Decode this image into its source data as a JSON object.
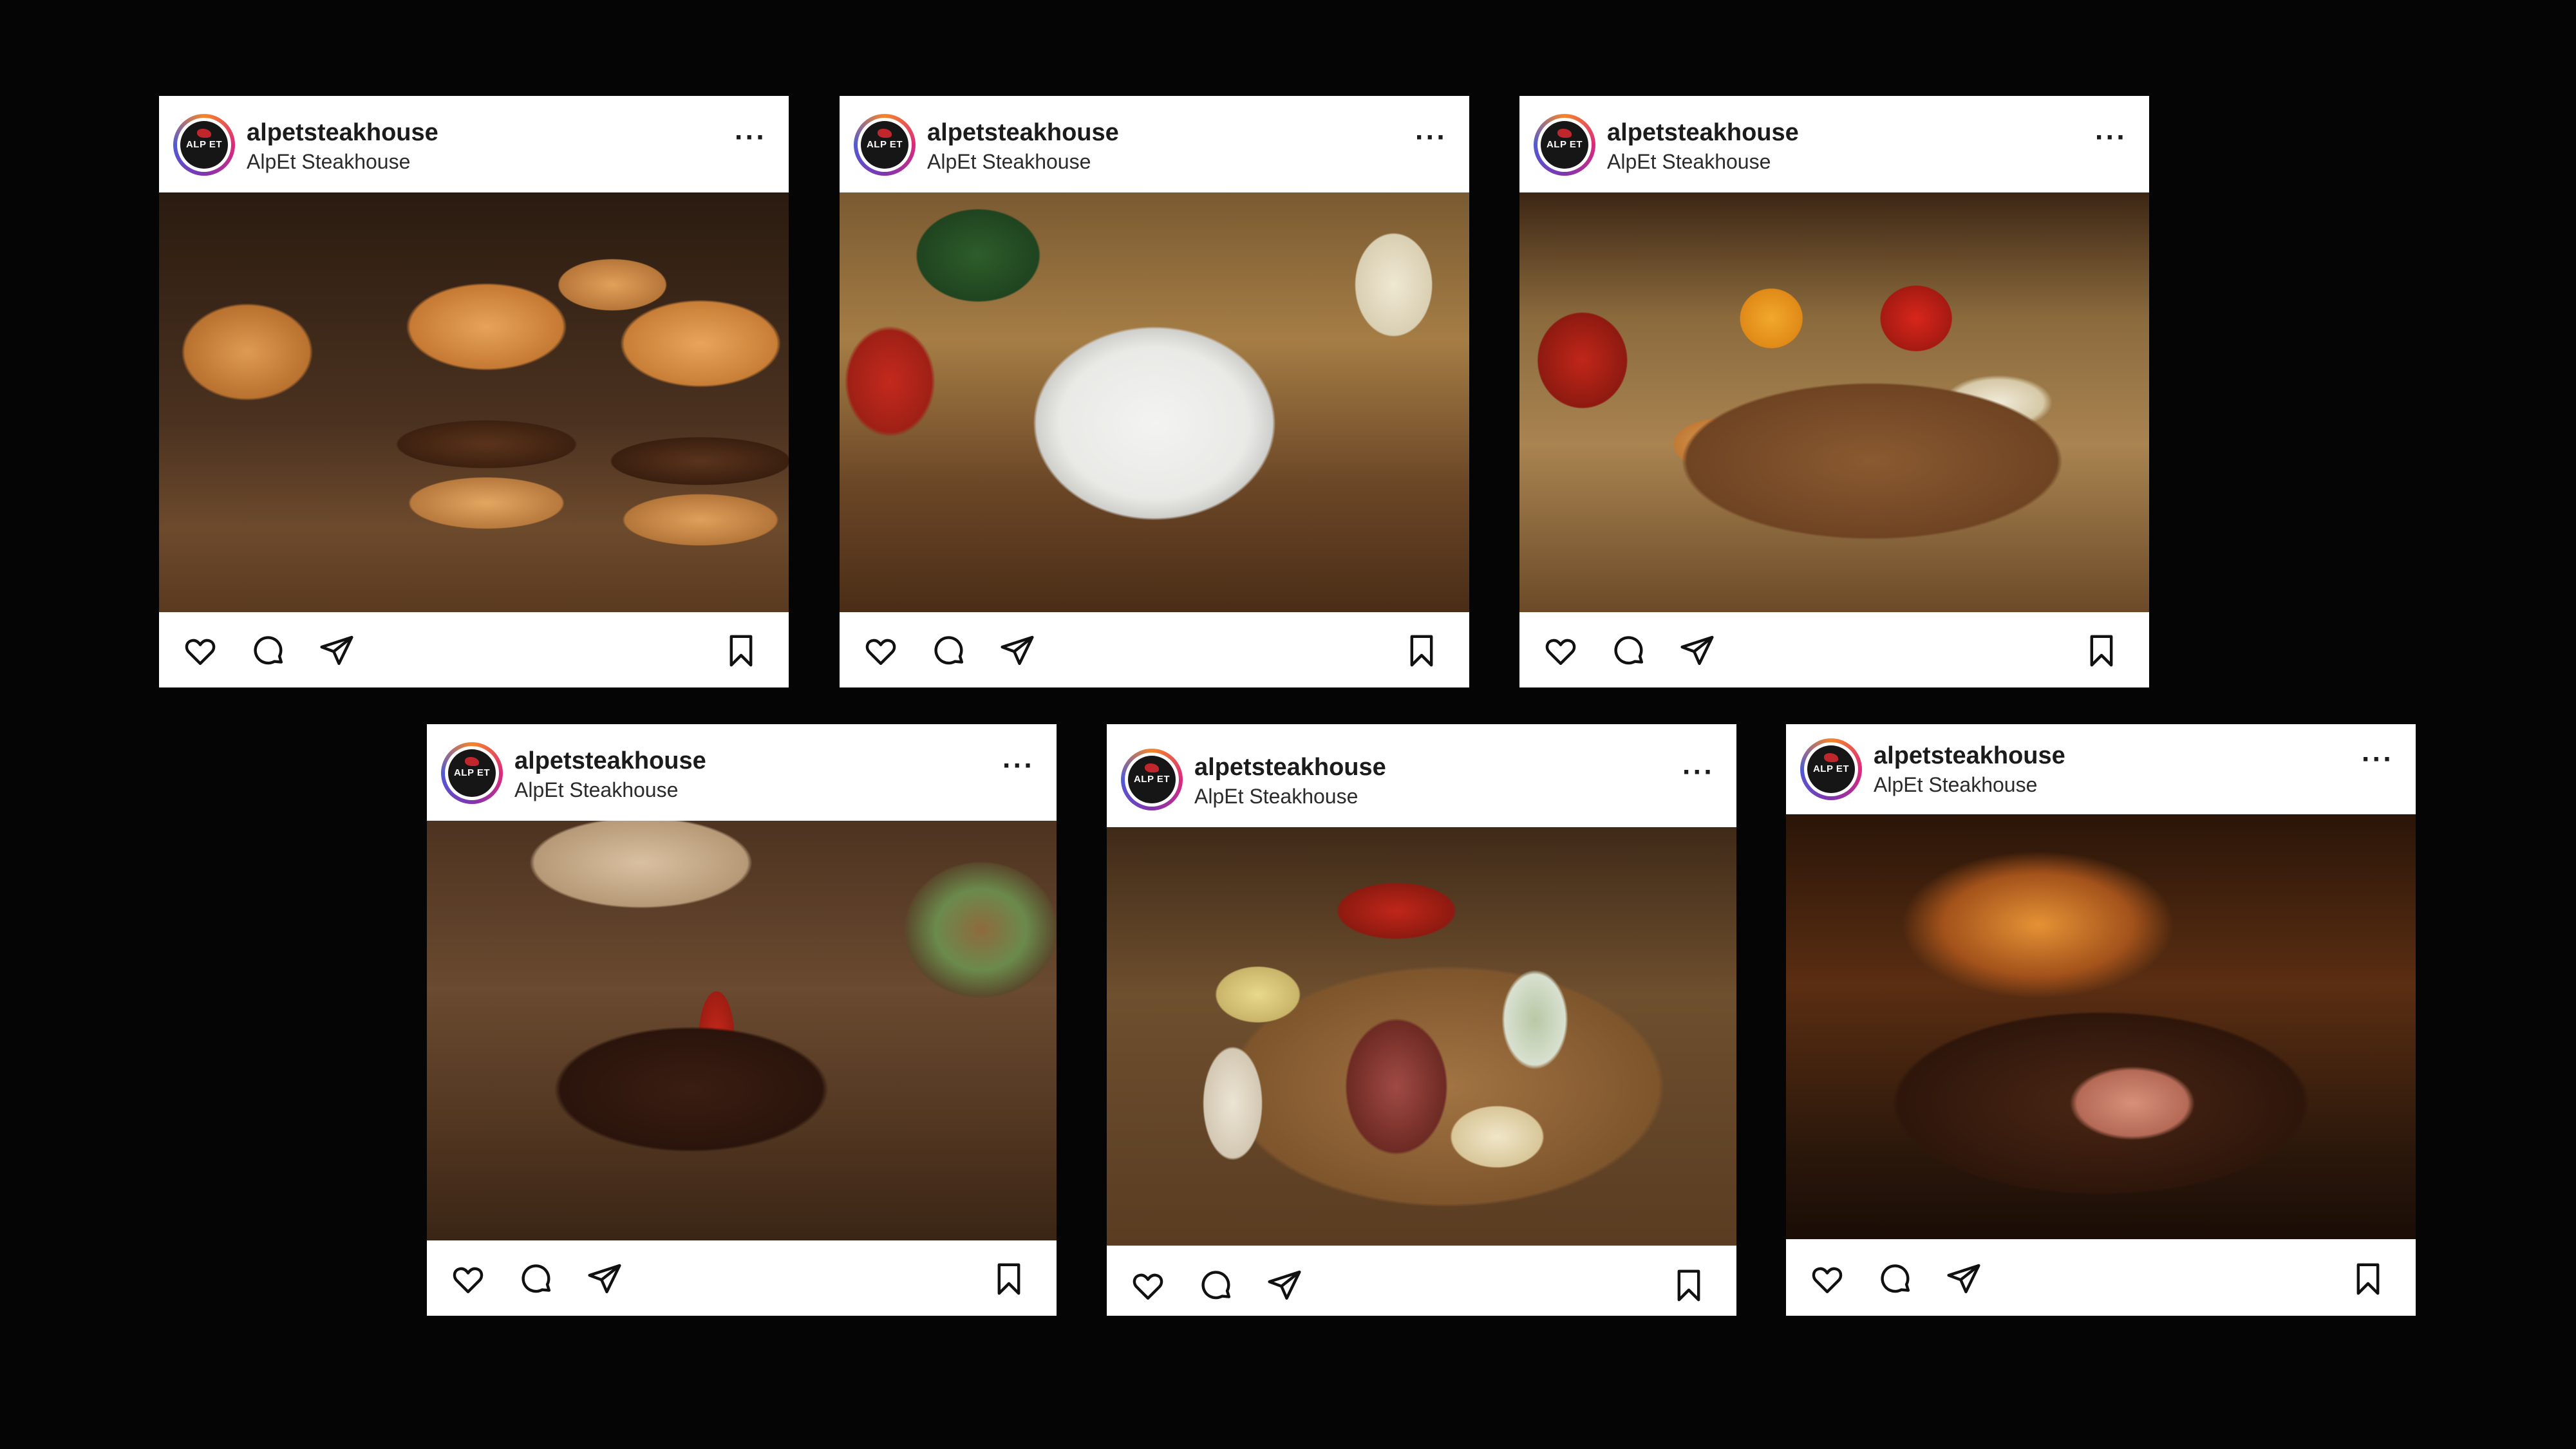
{
  "posts": [
    {
      "username": "alpetsteakhouse",
      "subname": "AlpEt Steakhouse",
      "photo": "burger sliders on wooden board",
      "avatar_text": "ALP ET"
    },
    {
      "username": "alpetsteakhouse",
      "subname": "AlpEt Steakhouse",
      "photo": "salad plate with tomatoes and quail eggs",
      "avatar_text": "ALP ET"
    },
    {
      "username": "alpetsteakhouse",
      "subname": "AlpEt Steakhouse",
      "photo": "bruschetta on wooden board",
      "avatar_text": "ALP ET"
    },
    {
      "username": "alpetsteakhouse",
      "subname": "AlpEt Steakhouse",
      "photo": "grilled steak with red chili pepper",
      "avatar_text": "ALP ET"
    },
    {
      "username": "alpetsteakhouse",
      "subname": "AlpEt Steakhouse",
      "photo": "sliced steak platter with fries and tortillas",
      "avatar_text": "ALP ET"
    },
    {
      "username": "alpetsteakhouse",
      "subname": "AlpEt Steakhouse",
      "photo": "sliced meat on dark cutting board",
      "avatar_text": "ALP ET"
    }
  ],
  "icons": {
    "more": "more-options-icon",
    "like": "heart-icon",
    "comment": "comment-icon",
    "share": "share-icon",
    "save": "bookmark-icon"
  },
  "colors": {
    "background": "#050505",
    "card": "#ffffff",
    "text": "#1b1b1b"
  }
}
